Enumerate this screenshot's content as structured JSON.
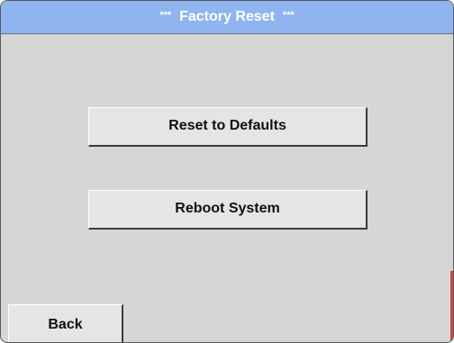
{
  "header": {
    "stars_left": "***",
    "title": "Factory Reset",
    "stars_right": "***"
  },
  "actions": {
    "reset_label": "Reset to Defaults",
    "reboot_label": "Reboot System"
  },
  "footer": {
    "back_label": "Back"
  },
  "colors": {
    "title_bar": "#8fb4f0",
    "background": "#d6d6d6",
    "button_face": "#e5e5e5"
  }
}
